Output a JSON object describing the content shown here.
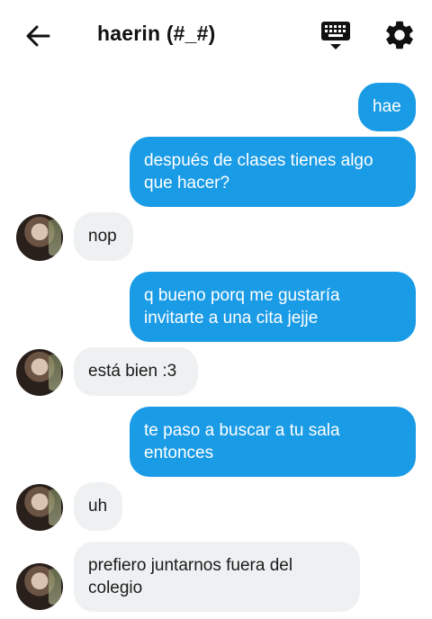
{
  "header": {
    "title": "haerin (#_#)",
    "back_icon": "arrow-left-icon",
    "keyboard_icon": "keyboard-icon",
    "settings_icon": "gear-icon"
  },
  "colors": {
    "outgoing_bubble": "#1a9be6",
    "incoming_bubble": "#eef0f2",
    "background": "#ffffff"
  },
  "messages": [
    {
      "side": "out",
      "text": "hae"
    },
    {
      "side": "out",
      "text": "después de clases tienes algo\nque hacer?"
    },
    {
      "side": "in",
      "text": "nop"
    },
    {
      "side": "out",
      "text": "q bueno porq me gustaría\ninvitarte a una cita jejje"
    },
    {
      "side": "in",
      "text": "está bien :3"
    },
    {
      "side": "out",
      "text": "te paso a buscar a tu sala\nentonces"
    },
    {
      "side": "in",
      "text": "uh"
    },
    {
      "side": "in",
      "text": "prefiero juntarnos fuera del\ncolegio"
    }
  ]
}
